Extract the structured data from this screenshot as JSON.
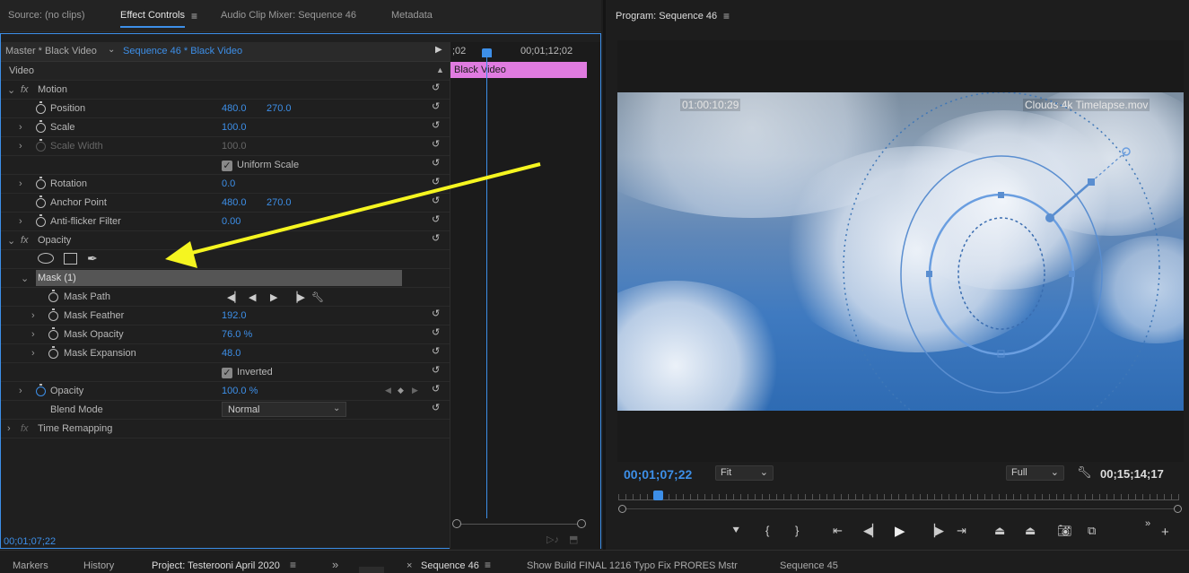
{
  "tabs": {
    "source": "Source: (no clips)",
    "effect_controls": "Effect Controls",
    "audio_clip_mixer": "Audio Clip Mixer: Sequence 46",
    "metadata": "Metadata"
  },
  "program": {
    "title": "Program: Sequence 46"
  },
  "clip_header": {
    "master": "Master * Black Video",
    "sequence": "Sequence 46 * Black Video"
  },
  "ec_timeline": {
    "timecode_left": ";02",
    "timecode_right": "00;01;12;02",
    "clip_label": "Black Video"
  },
  "section_video": "Video",
  "motion": {
    "label": "Motion",
    "position": {
      "label": "Position",
      "x": "480.0",
      "y": "270.0"
    },
    "scale": {
      "label": "Scale",
      "value": "100.0"
    },
    "scale_width": {
      "label": "Scale Width",
      "value": "100.0"
    },
    "uniform_scale": "Uniform Scale",
    "rotation": {
      "label": "Rotation",
      "value": "0.0"
    },
    "anchor_point": {
      "label": "Anchor Point",
      "x": "480.0",
      "y": "270.0"
    },
    "anti_flicker": {
      "label": "Anti-flicker Filter",
      "value": "0.00"
    }
  },
  "opacity": {
    "label": "Opacity",
    "mask_label": "Mask (1)",
    "mask_path": "Mask Path",
    "mask_feather": {
      "label": "Mask Feather",
      "value": "192.0"
    },
    "mask_opacity": {
      "label": "Mask Opacity",
      "value": "76.0 %"
    },
    "mask_expansion": {
      "label": "Mask Expansion",
      "value": "48.0"
    },
    "inverted": "Inverted",
    "opacity_value": {
      "label": "Opacity",
      "value": "100.0 %"
    },
    "blend_mode": {
      "label": "Blend Mode",
      "value": "Normal"
    }
  },
  "time_remapping": "Time Remapping",
  "ec_footer_timecode": "00;01;07;22",
  "video_overlay": {
    "timecode": "01:00:10:29",
    "clip_name": "Clouds 4k Timelapse.mov"
  },
  "pm": {
    "current_timecode": "00;01;07;22",
    "fit": "Fit",
    "quality": "Full",
    "duration": "00;15;14;17",
    "scrub_position": 0.07
  },
  "bottom_tabs": {
    "markers": "Markers",
    "history": "History",
    "project": "Project: Testerooni April 2020",
    "sequence46": "Sequence 46",
    "show_build": "Show Build FINAL 1216 Typo Fix PRORES Mstr",
    "sequence45": "Sequence 45"
  },
  "colors": {
    "accent": "#3d8fe8",
    "clip": "#e07be0",
    "arrow": "#f5f520"
  }
}
